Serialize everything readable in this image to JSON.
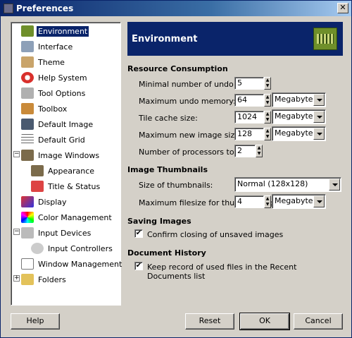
{
  "window": {
    "title": "Preferences"
  },
  "sidebar": {
    "items": [
      {
        "label": "Environment"
      },
      {
        "label": "Interface"
      },
      {
        "label": "Theme"
      },
      {
        "label": "Help System"
      },
      {
        "label": "Tool Options"
      },
      {
        "label": "Toolbox"
      },
      {
        "label": "Default Image"
      },
      {
        "label": "Default Grid"
      },
      {
        "label": "Image Windows"
      },
      {
        "label": "Appearance"
      },
      {
        "label": "Title & Status"
      },
      {
        "label": "Display"
      },
      {
        "label": "Color Management"
      },
      {
        "label": "Input Devices"
      },
      {
        "label": "Input Controllers"
      },
      {
        "label": "Window Management"
      },
      {
        "label": "Folders"
      }
    ]
  },
  "panel": {
    "title": "Environment",
    "resource": {
      "heading": "Resource Consumption",
      "undo_levels_label": "Minimal number of undo levels:",
      "undo_levels_value": "5",
      "undo_memory_label": "Maximum undo memory:",
      "undo_memory_value": "64",
      "undo_memory_unit": "Megabytes",
      "tile_cache_label": "Tile cache size:",
      "tile_cache_value": "1024",
      "tile_cache_unit": "Megabytes",
      "max_image_label": "Maximum new image size:",
      "max_image_value": "128",
      "max_image_unit": "Megabytes",
      "processors_label": "Number of processors to use:",
      "processors_value": "2"
    },
    "thumbnails": {
      "heading": "Image Thumbnails",
      "size_label": "Size of thumbnails:",
      "size_value": "Normal (128x128)",
      "filesize_label": "Maximum filesize for thumbnailing:",
      "filesize_value": "4",
      "filesize_unit": "Megabytes"
    },
    "saving": {
      "heading": "Saving Images",
      "confirm_label": "Confirm closing of unsaved images",
      "confirm_checked": "✔"
    },
    "history": {
      "heading": "Document History",
      "record_label": "Keep record of used files in the Recent Documents list",
      "record_checked": "✔"
    }
  },
  "buttons": {
    "help": "Help",
    "reset": "Reset",
    "ok": "OK",
    "cancel": "Cancel"
  }
}
